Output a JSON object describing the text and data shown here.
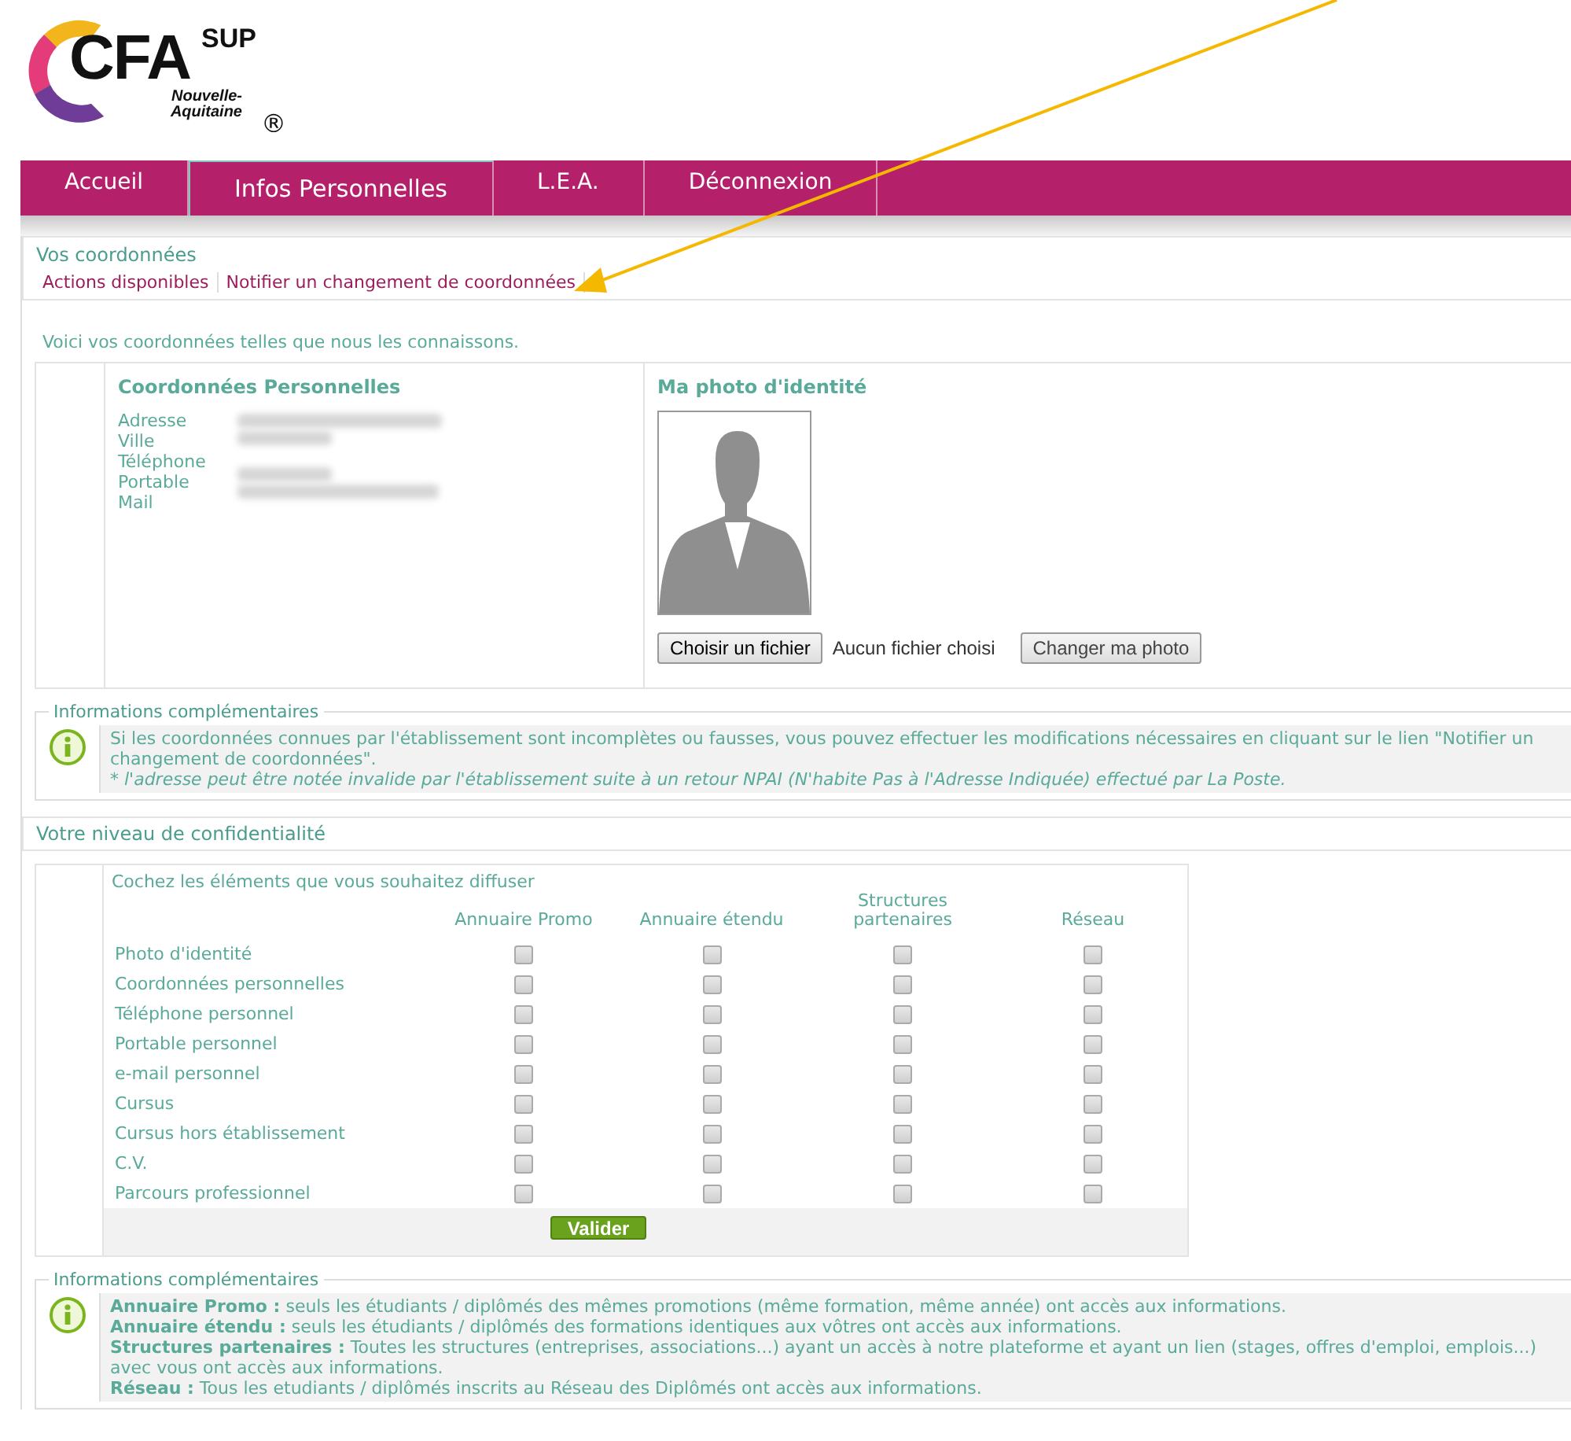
{
  "logo": {
    "name": "CFA",
    "superscript": "SUP",
    "region": "Nouvelle-Aquitaine",
    "registered": "®"
  },
  "nav": {
    "tabs": [
      {
        "label": "Accueil",
        "selected": false
      },
      {
        "label": "Infos Personnelles",
        "selected": true
      },
      {
        "label": "L.E.A.",
        "selected": false
      },
      {
        "label": "Déconnexion",
        "selected": false
      }
    ]
  },
  "coordinates": {
    "title": "Vos coordonnées",
    "actions": [
      "Actions disponibles",
      "Notifier un changement de coordonnées"
    ],
    "intro": "Voici vos coordonnées telles que nous les connaissons.",
    "personal": {
      "title": "Coordonnées Personnelles",
      "fields": [
        "Adresse",
        "Ville",
        "Téléphone",
        "Portable",
        "Mail"
      ]
    },
    "photo": {
      "title": "Ma photo d'identité",
      "file_button": "Choisir un fichier",
      "file_status": "Aucun fichier choisi",
      "change_button": "Changer ma photo"
    },
    "info": {
      "legend": "Informations complémentaires",
      "lines": [
        "Si les coordonnées connues par l'établissement sont incomplètes ou fausses, vous pouvez effectuer les modifications nécessaires en cliquant sur le lien \"Notifier un changement de coordonnées\".",
        "* l'adresse peut être notée invalide par l'établissement suite à un retour NPAI (N'habite Pas à l'Adresse Indiquée) effectué par La Poste."
      ]
    }
  },
  "privacy": {
    "title": "Votre niveau de confidentialité",
    "instruction": "Cochez les éléments que vous souhaitez diffuser",
    "columns": [
      "Annuaire Promo",
      "Annuaire étendu",
      "Structures partenaires",
      "Réseau"
    ],
    "rows": [
      {
        "label": "Photo d'identité",
        "checks": [
          false,
          false,
          false,
          false
        ]
      },
      {
        "label": "Coordonnées personnelles",
        "checks": [
          false,
          false,
          false,
          false
        ]
      },
      {
        "label": "Téléphone personnel",
        "checks": [
          false,
          false,
          false,
          false
        ]
      },
      {
        "label": "Portable personnel",
        "checks": [
          false,
          false,
          false,
          false
        ]
      },
      {
        "label": "e-mail personnel",
        "checks": [
          false,
          false,
          false,
          false
        ]
      },
      {
        "label": "Cursus",
        "checks": [
          false,
          false,
          false,
          false
        ]
      },
      {
        "label": "Cursus hors établissement",
        "checks": [
          false,
          false,
          false,
          false
        ]
      },
      {
        "label": "C.V.",
        "checks": [
          false,
          false,
          false,
          false
        ]
      },
      {
        "label": "Parcours professionnel",
        "checks": [
          false,
          false,
          false,
          false
        ]
      }
    ],
    "submit": "Valider",
    "info": {
      "legend": "Informations complémentaires",
      "lines": [
        "**Annuaire Promo :** seuls les étudiants / diplômés des mêmes promotions (même formation, même année) ont accès aux informations.",
        "**Annuaire étendu :** seuls les étudiants / diplômés des formations identiques aux vôtres ont accès aux informations.",
        "**Structures partenaires :** Toutes les structures (entreprises, associations...) ayant un accès à notre plateforme et ayant un lien (stages, offres d'emploi, emplois...) avec vous ont accès aux informations.",
        "**Réseau :** Tous les etudiants / diplômés inscrits au Réseau des Diplômés ont accès aux informations."
      ]
    }
  }
}
